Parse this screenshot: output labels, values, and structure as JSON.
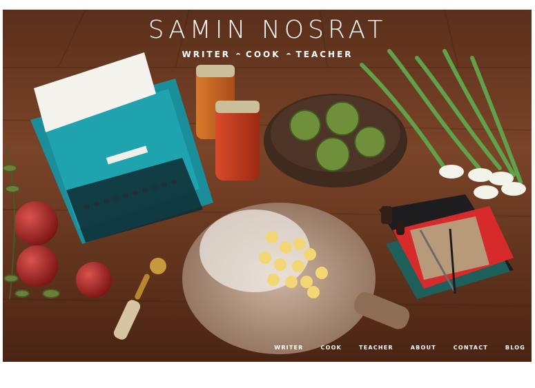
{
  "site": {
    "title": "SAMIN NOSRAT",
    "tagline": {
      "items": [
        "WRITER",
        "COOK",
        "TEACHER"
      ]
    }
  },
  "nav": {
    "items": [
      "WRITER",
      "COOK",
      "TEACHER",
      "ABOUT",
      "CONTACT",
      "BLOG"
    ]
  },
  "hero": {
    "typewriter_brand": "olivetti  STUDIO 45"
  },
  "colors": {
    "wood": "#6b3b22",
    "typewriter": "#1b9aa6",
    "text": "#ffffff"
  }
}
